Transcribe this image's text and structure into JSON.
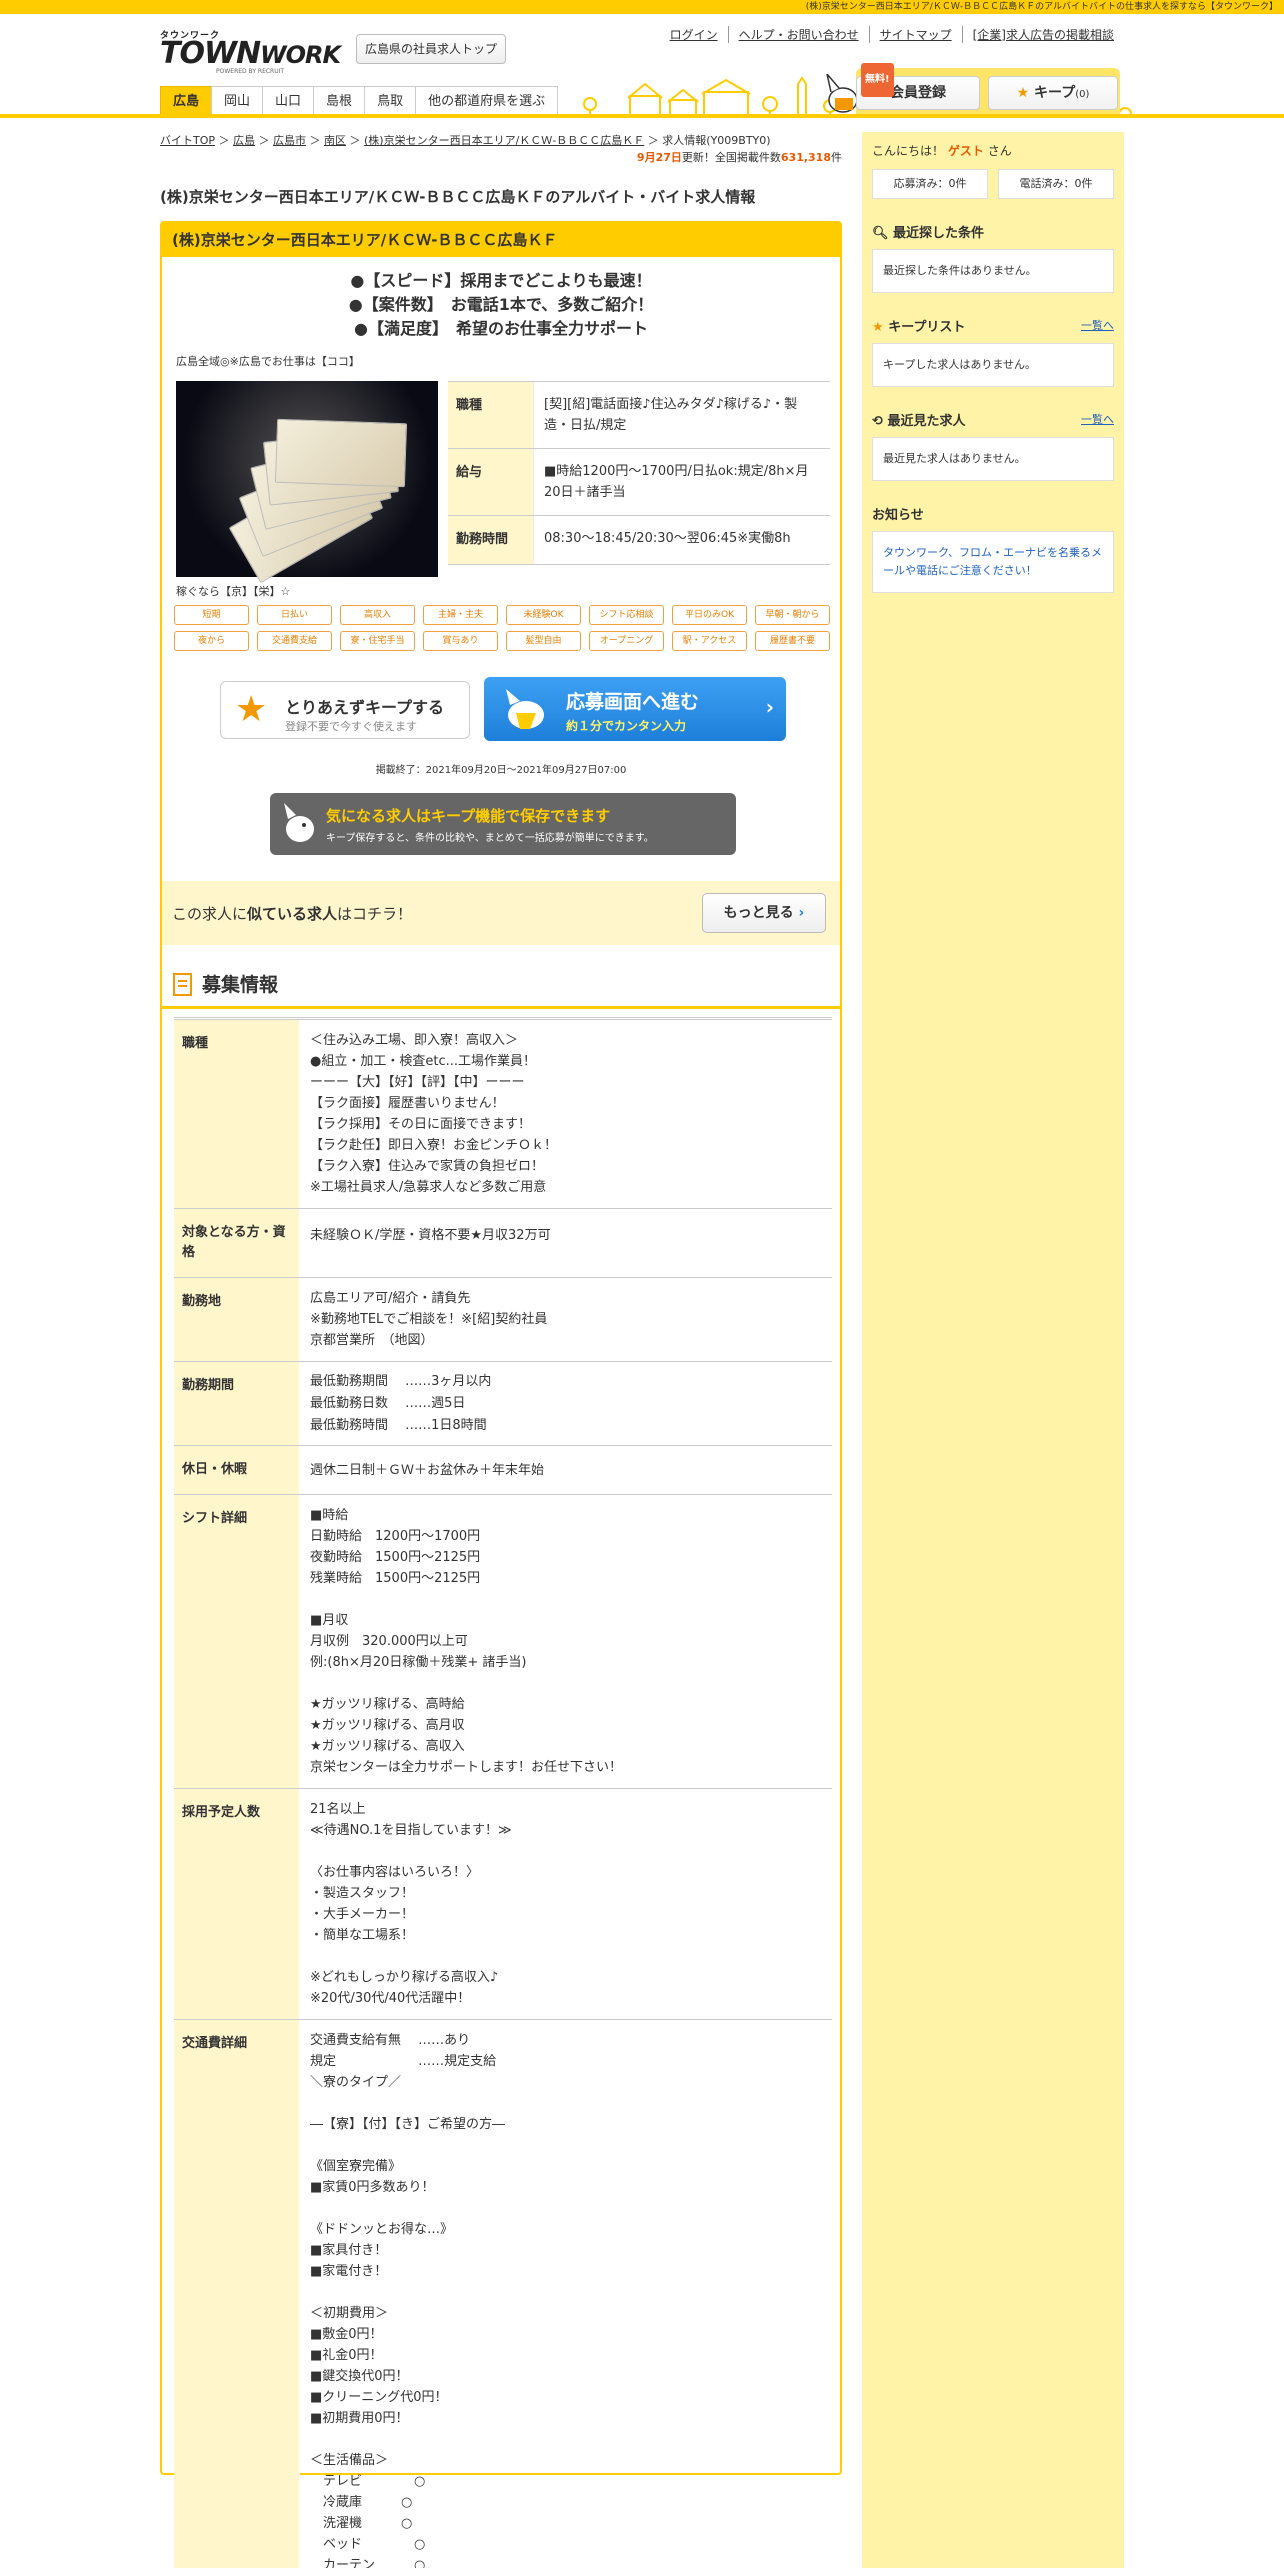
{
  "top_banner": "(株)京栄センター西日本エリア/ＫＣＷ-ＢＢＣＣ広島ＫＦのアルバイトバイトの仕事求人を探すなら【タウンワーク】",
  "logo": {
    "kana": "タウンワーク",
    "town": "TOWN",
    "work": "WORK",
    "powered": "POWERED BY RECRUIT"
  },
  "header": {
    "top_button": "広島県の社員求人トップ",
    "links": [
      "ログイン",
      "ヘルプ・お問い合わせ",
      "サイトマップ",
      "[企業]求人広告の掲載相談"
    ],
    "tabs": [
      "広島",
      "岡山",
      "山口",
      "島根",
      "鳥取",
      "他の都道府県を選ぶ"
    ],
    "free": "無料!",
    "register": "会員登録",
    "keep": "キープ",
    "keep_count": "(0)"
  },
  "breadcrumb": [
    "バイトTOP",
    "広島",
    "広島市",
    "南区",
    "(株)京栄センター西日本エリア/ＫＣＷ-ＢＢＣＣ広島ＫＦ",
    "求人情報(Y009BTY0)"
  ],
  "update": {
    "date": "9月27日",
    "mid": "更新！全国掲載件数",
    "count": "631,318",
    "unit": "件"
  },
  "page_title": "(株)京栄センター西日本エリア/ＫＣＷ-ＢＢＣＣ広島ＫＦのアルバイト・バイト求人情報",
  "job": {
    "company": "(株)京栄センター西日本エリア/ＫＣＷ-ＢＢＣＣ広島ＫＦ",
    "points": [
      "●【スピード】採用までどこよりも最速！",
      "●【案件数】　お電話1本で、多数ご紹介！",
      "●【満足度】　希望のお仕事全力サポート"
    ],
    "area": "広島全域◎※広島でお仕事は【ココ】",
    "caption": "稼ぐなら【京】【栄】☆",
    "summary": [
      {
        "label": "職種",
        "value": "[契][紹]電話面接♪住込みタダ♪稼げる♪・製造・日払/規定"
      },
      {
        "label": "給与",
        "value": "■時給1200円～1700円/日払ok:規定/8h×月20日＋諸手当"
      },
      {
        "label": "勤務時間",
        "value": "08:30～18:45/20:30～翌06:45※実働8h"
      }
    ],
    "tags": [
      "短期",
      "日払い",
      "高収入",
      "主婦・主夫",
      "未経験OK",
      "シフト応相談",
      "平日のみOK",
      "早朝・朝から",
      "夜から",
      "交通費支給",
      "寮・住宅手当",
      "賞与あり",
      "髪型自由",
      "オープニング",
      "駅・アクセス",
      "履歴書不要"
    ],
    "keep_btn": {
      "main": "とりあえずキープする",
      "sub": "登録不要で今すぐ使えます"
    },
    "apply_btn": {
      "main": "応募画面へ進む",
      "sub": "約１分でカンタン入力"
    },
    "period": "掲載終了：2021年09月20日～2021年09月27日07:00",
    "promo": {
      "main": "気になる求人はキープ機能で保存できます",
      "sub": "キープ保存すると、条件の比較や、まとめて一括応募が簡単にできます。"
    },
    "similar": {
      "pre": "この求人に",
      "bold": "似ている求人",
      "post": "はコチラ！",
      "btn": "もっと見る"
    }
  },
  "recruit": {
    "title": "募集情報",
    "rows": [
      {
        "label": "職種",
        "value": "＜住み込み工場、即入寮！高収入＞\n●組立・加工・検査etc...工場作業員！\nーーー【大】【好】【評】【中】ーーー\n【ラク面接】履歴書いりません！\n【ラク採用】その日に面接できます！\n【ラク赴任】即日入寮！お金ピンチＯｋ！\n【ラク入寮】住込みで家賃の負担ゼロ！\n※工場社員求人/急募求人など多数ご用意"
      },
      {
        "label": "対象となる方・資格",
        "value": "未経験ＯＫ/学歴・資格不要★月収32万可"
      },
      {
        "label": "勤務地",
        "value": "広島エリア可/紹介・請負先\n※勤務地TELでご相談を！※[紹]契約社員\n京都営業所　（地図）"
      },
      {
        "label": "勤務期間",
        "value": "最低勤務期間　 ……3ヶ月以内\n\n最低勤務日数　 ……週5日\n\n最低勤務時間　 ……1日8時間"
      },
      {
        "label": "休日・休暇",
        "value": "週休二日制＋ＧＷ＋お盆休み＋年末年始"
      },
      {
        "label": "シフト詳細",
        "value": "■時給\n日勤時給　1200円～1700円\n夜勤時給　1500円～2125円\n残業時給　1500円～2125円\n\n■月収\n月収例　320.000円以上可\n例:(8h×月20日稼働＋残業+ 諸手当)\n\n★ガッツリ稼げる、高時給\n★ガッツリ稼げる、高月収\n★ガッツリ稼げる、高収入\n京栄センターは全力サポートします！お任せ下さい！"
      },
      {
        "label": "採用予定人数",
        "value": "21名以上\n≪待遇NO.1を目指しています！≫\n\n〈お仕事内容はいろいろ！〉\n・製造スタッフ！\n・大手メーカー！\n・簡単な工場系！\n\n※どれもしっかり稼げる高収入♪\n※20代/30代/40代活躍中！"
      },
      {
        "label": "交通費詳細",
        "value": "交通費支給有無　 ……あり\n規定　　　　　　 ……規定支給\n＼寮のタイプ／\n\n―【寮】【付】【き】ご希望の方―\n\n《個室寮完備》\n■家賃0円多数あり！\n\n《ドドンッとお得な…》\n■家具付き！\n■家電付き！\n\n＜初期費用＞\n■敷金0円！\n■礼金0円！\n■鍵交換代0円！\n■クリーニング代0円！\n■初期費用0円！\n\n＜生活備品＞\n　テレビ　　　　○\n　冷蔵庫　　　○\n　洗濯機　　　○\n　ベッド　　　　○\n　カーテン　　　○\n　エアコン　　　○"
      }
    ]
  },
  "sidebar": {
    "greet_pre": "こんにちは！",
    "guest": "ゲスト",
    "greet_post": "さん",
    "applied": "応募済み：0件",
    "called": "電話済み：0件",
    "recent_title": "最近探した条件",
    "recent_empty": "最近探した条件はありません。",
    "keep_title": "キープリスト",
    "keep_link": "一覧へ",
    "keep_empty": "キープした求人はありません。",
    "viewed_title": "最近見た求人",
    "viewed_link": "一覧へ",
    "viewed_empty": "最近見た求人はありません。",
    "notice_title": "お知らせ",
    "notice_text": "タウンワーク、フロム・エーナビを名乗るメールや電話にご注意ください！"
  },
  "colors": {
    "brand": "#ffcc00",
    "accent": "#e65a00",
    "apply": "#1d7fd8",
    "side": "#fff3a8"
  }
}
